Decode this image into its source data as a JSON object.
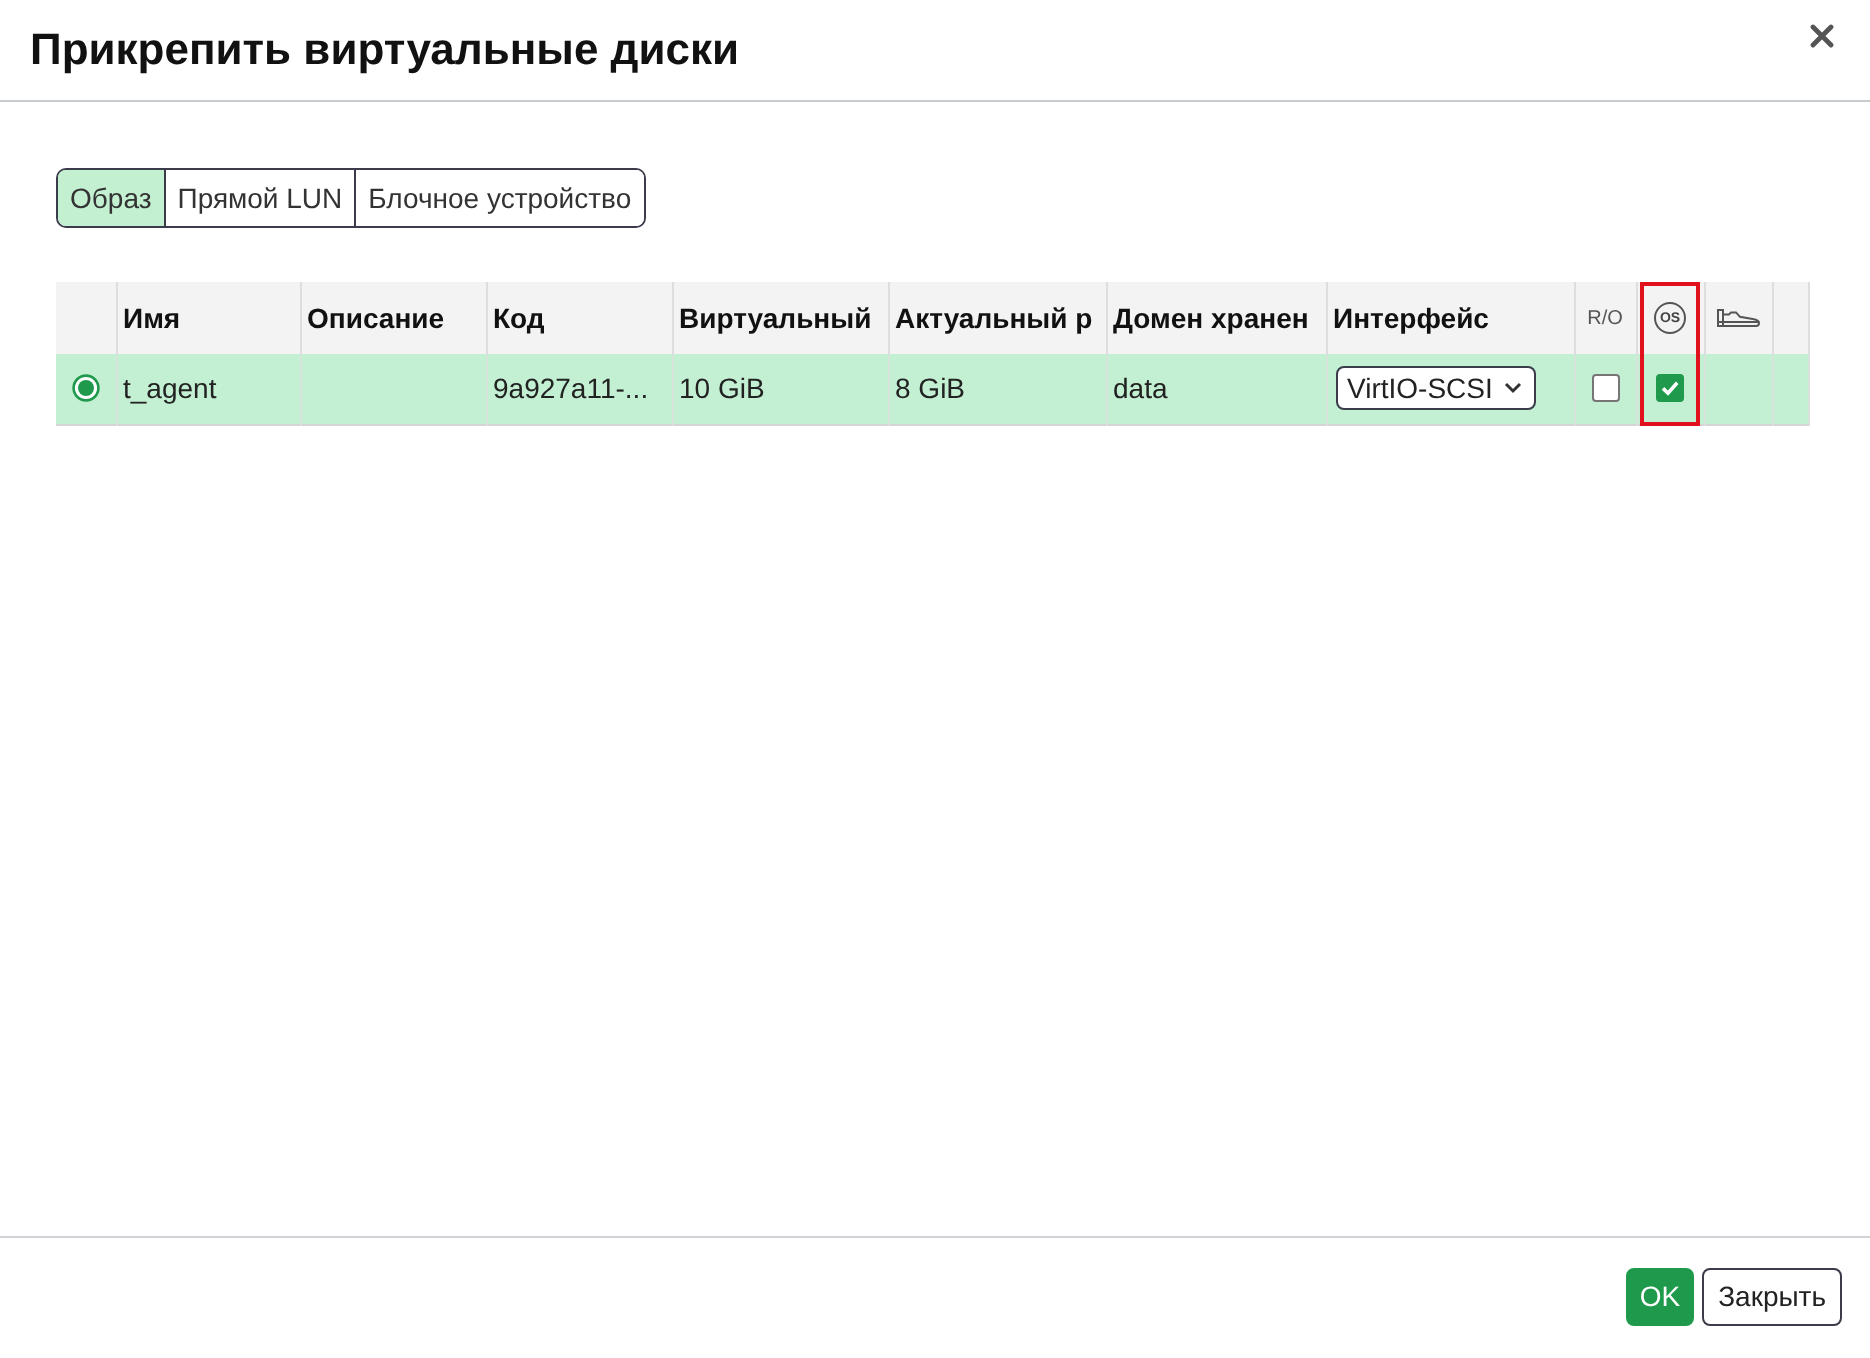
{
  "dialog": {
    "title": "Прикрепить виртуальные диски"
  },
  "tabs": [
    {
      "label": "Образ",
      "selected": true
    },
    {
      "label": "Прямой LUN",
      "selected": false
    },
    {
      "label": "Блочное устройство",
      "selected": false
    }
  ],
  "table": {
    "columns": [
      {
        "kind": "blank",
        "highlighted": false
      },
      {
        "kind": "text",
        "label": "Имя",
        "highlighted": false
      },
      {
        "kind": "text",
        "label": "Описание",
        "highlighted": false
      },
      {
        "kind": "text",
        "label": "Код",
        "highlighted": false
      },
      {
        "kind": "text",
        "label": "Виртуальный",
        "highlighted": false
      },
      {
        "kind": "text",
        "label": "Актуальный р",
        "highlighted": false
      },
      {
        "kind": "text",
        "label": "Домен хранен",
        "highlighted": false
      },
      {
        "kind": "text",
        "label": "Интерфейс",
        "highlighted": false
      },
      {
        "kind": "small",
        "label": "R/O",
        "highlighted": false
      },
      {
        "kind": "circled",
        "label": "OS",
        "highlighted": true
      },
      {
        "kind": "icon",
        "highlighted": false
      },
      {
        "kind": "blank",
        "highlighted": false
      }
    ],
    "rows": [
      {
        "selected": true,
        "name": "t_agent",
        "code": "9a927a11-...",
        "virtual_size": "10 GiB",
        "actual_size": "8 GiB",
        "storage_domain": "data",
        "interface": "VirtIO-SCSI",
        "read_only": false,
        "os": true
      }
    ]
  },
  "buttons": [
    {
      "label": "OK",
      "kind": "primary"
    },
    {
      "label": "Закрыть",
      "kind": "secondary"
    }
  ]
}
